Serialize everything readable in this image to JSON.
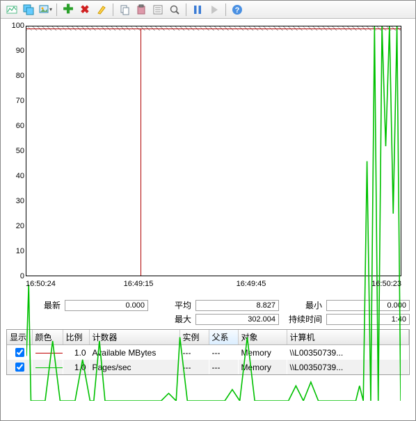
{
  "toolbar": {
    "view_current": "view-current",
    "view_log": "view-log",
    "gallery": "gallery",
    "add": "add",
    "remove": "remove",
    "highlight": "highlight",
    "copy": "copy",
    "paste": "paste",
    "properties": "properties",
    "zoom": "zoom",
    "freeze": "freeze",
    "update": "update",
    "help": "help"
  },
  "stats": {
    "last_label": "最新",
    "last_value": "0.000",
    "avg_label": "平均",
    "avg_value": "8.827",
    "min_label": "最小",
    "min_value": "0.000",
    "max_label": "最大",
    "max_value": "302.004",
    "dur_label": "持续时间",
    "dur_value": "1:40"
  },
  "table": {
    "headers": {
      "show": "显示",
      "color": "颜色",
      "scale": "比例",
      "counter": "计数器",
      "instance": "实例",
      "parent": "父系",
      "object": "对象",
      "computer": "计算机"
    },
    "rows": [
      {
        "checked": true,
        "lineColor": "#c00000",
        "scale": "1.0",
        "counter": "Available MBytes",
        "instance": "---",
        "parent": "---",
        "object": "Memory",
        "computer": "\\\\L00350739..."
      },
      {
        "checked": true,
        "lineColor": "#00c000",
        "scale": "1.0",
        "counter": "Pages/sec",
        "instance": "---",
        "parent": "---",
        "object": "Memory",
        "computer": "\\\\L00350739..."
      }
    ]
  },
  "chart_data": {
    "type": "line",
    "ylim": [
      0,
      100
    ],
    "y_ticks": [
      0,
      10,
      20,
      30,
      40,
      50,
      60,
      70,
      80,
      90,
      100
    ],
    "x_ticks": [
      "16:50:24",
      "16:49:15",
      "16:49:45",
      "16:50:23"
    ],
    "x_tick_positions_pct": [
      0,
      30,
      60,
      100
    ],
    "cursor_x_pct": 30.5,
    "series": [
      {
        "name": "Available MBytes",
        "color": "#c00000",
        "note": "flat at 100 (off-scale line at top)"
      },
      {
        "name": "Pages/sec",
        "color": "#00c000",
        "points": [
          [
            0,
            12
          ],
          [
            0.6,
            31
          ],
          [
            1.2,
            0
          ],
          [
            5,
            0
          ],
          [
            7,
            16
          ],
          [
            9,
            0
          ],
          [
            13,
            0
          ],
          [
            15,
            11
          ],
          [
            17,
            0
          ],
          [
            18,
            0
          ],
          [
            19.5,
            16
          ],
          [
            21,
            0
          ],
          [
            31,
            0
          ],
          [
            31,
            0
          ],
          [
            36,
            0
          ],
          [
            38,
            2
          ],
          [
            40,
            0
          ],
          [
            41,
            17
          ],
          [
            43,
            0
          ],
          [
            53,
            0
          ],
          [
            55,
            3
          ],
          [
            57,
            0
          ],
          [
            59,
            17
          ],
          [
            61,
            0
          ],
          [
            70,
            0
          ],
          [
            72,
            4
          ],
          [
            74,
            0
          ],
          [
            76,
            5
          ],
          [
            78,
            0
          ],
          [
            88,
            0
          ],
          [
            89,
            4
          ],
          [
            90,
            0
          ],
          [
            91,
            64
          ],
          [
            92,
            0
          ],
          [
            93,
            100
          ],
          [
            94,
            0
          ],
          [
            95,
            100
          ],
          [
            96,
            68
          ],
          [
            97,
            100
          ],
          [
            98,
            50
          ],
          [
            99,
            100
          ],
          [
            100,
            0
          ]
        ]
      }
    ]
  }
}
